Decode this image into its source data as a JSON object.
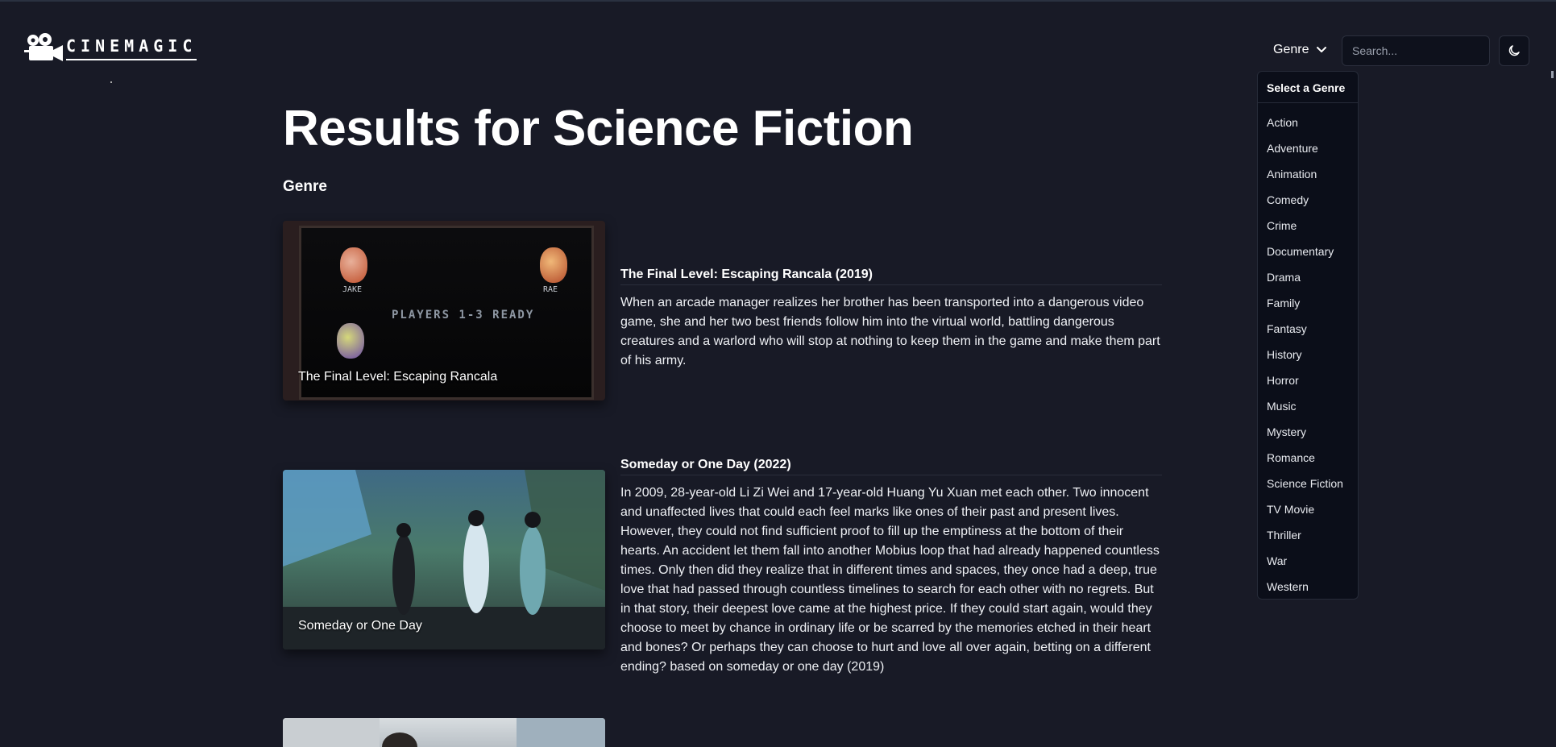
{
  "brand": {
    "name": "CINEMAGIC"
  },
  "header": {
    "genre_label": "Genre",
    "search_placeholder": "Search...",
    "theme_icon": "moon-icon"
  },
  "dropdown": {
    "title": "Select a Genre",
    "genres": [
      "Action",
      "Adventure",
      "Animation",
      "Comedy",
      "Crime",
      "Documentary",
      "Drama",
      "Family",
      "Fantasy",
      "History",
      "Horror",
      "Music",
      "Mystery",
      "Romance",
      "Science Fiction",
      "TV Movie",
      "Thriller",
      "War",
      "Western"
    ]
  },
  "main": {
    "title": "Results for Science Fiction",
    "section_label": "Genre",
    "movies": [
      {
        "caption": "The Final Level: Escaping Rancala",
        "title": "The Final Level: Escaping Rancala (2019)",
        "description": "When an arcade manager realizes her brother has been transported into a dangerous video game, she and her two best friends follow him into the virtual world, battling dangerous creatures and a warlord who will stop at nothing to keep them in the game and make them part of his army.",
        "poster_labels": [
          "JAKE",
          "RAE"
        ],
        "poster_banner": "PLAYERS 1-3 READY"
      },
      {
        "caption": "Someday or One Day",
        "title": "Someday or One Day (2022)",
        "description": "In 2009, 28-year-old Li Zi Wei and 17-year-old Huang Yu Xuan met each other. Two innocent and unaffected lives that could each feel marks like ones of their past and present lives. However, they could not find sufficient proof to fill up the emptiness at the bottom of their hearts. An accident let them fall into another Mobius loop that had already happened countless times. Only then did they realize that in different times and spaces, they once had a deep, true love that had passed through countless timelines to search for each other with no regrets. But in that story, their deepest love came at the highest price. If they could start again, would they choose to meet by chance in ordinary life or be scarred by the memories etched in their heart and bones? Or perhaps they can choose to hurt and love all over again, betting on a different ending? based on someday or one day (2019)"
      }
    ]
  }
}
